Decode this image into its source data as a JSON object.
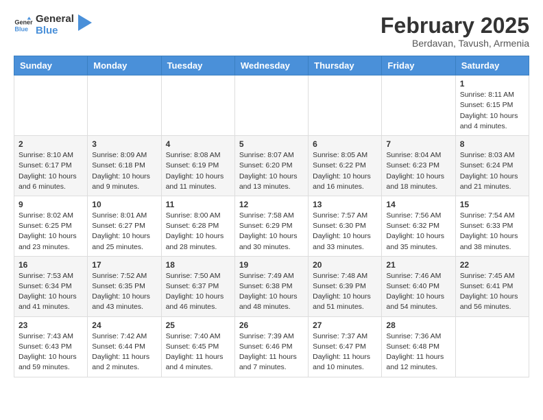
{
  "header": {
    "logo": {
      "general": "General",
      "blue": "Blue"
    },
    "title": "February 2025",
    "subtitle": "Berdavan, Tavush, Armenia"
  },
  "calendar": {
    "weekdays": [
      "Sunday",
      "Monday",
      "Tuesday",
      "Wednesday",
      "Thursday",
      "Friday",
      "Saturday"
    ],
    "weeks": [
      [
        {
          "day": "",
          "info": ""
        },
        {
          "day": "",
          "info": ""
        },
        {
          "day": "",
          "info": ""
        },
        {
          "day": "",
          "info": ""
        },
        {
          "day": "",
          "info": ""
        },
        {
          "day": "",
          "info": ""
        },
        {
          "day": "1",
          "info": "Sunrise: 8:11 AM\nSunset: 6:15 PM\nDaylight: 10 hours and 4 minutes."
        }
      ],
      [
        {
          "day": "2",
          "info": "Sunrise: 8:10 AM\nSunset: 6:17 PM\nDaylight: 10 hours and 6 minutes."
        },
        {
          "day": "3",
          "info": "Sunrise: 8:09 AM\nSunset: 6:18 PM\nDaylight: 10 hours and 9 minutes."
        },
        {
          "day": "4",
          "info": "Sunrise: 8:08 AM\nSunset: 6:19 PM\nDaylight: 10 hours and 11 minutes."
        },
        {
          "day": "5",
          "info": "Sunrise: 8:07 AM\nSunset: 6:20 PM\nDaylight: 10 hours and 13 minutes."
        },
        {
          "day": "6",
          "info": "Sunrise: 8:05 AM\nSunset: 6:22 PM\nDaylight: 10 hours and 16 minutes."
        },
        {
          "day": "7",
          "info": "Sunrise: 8:04 AM\nSunset: 6:23 PM\nDaylight: 10 hours and 18 minutes."
        },
        {
          "day": "8",
          "info": "Sunrise: 8:03 AM\nSunset: 6:24 PM\nDaylight: 10 hours and 21 minutes."
        }
      ],
      [
        {
          "day": "9",
          "info": "Sunrise: 8:02 AM\nSunset: 6:25 PM\nDaylight: 10 hours and 23 minutes."
        },
        {
          "day": "10",
          "info": "Sunrise: 8:01 AM\nSunset: 6:27 PM\nDaylight: 10 hours and 25 minutes."
        },
        {
          "day": "11",
          "info": "Sunrise: 8:00 AM\nSunset: 6:28 PM\nDaylight: 10 hours and 28 minutes."
        },
        {
          "day": "12",
          "info": "Sunrise: 7:58 AM\nSunset: 6:29 PM\nDaylight: 10 hours and 30 minutes."
        },
        {
          "day": "13",
          "info": "Sunrise: 7:57 AM\nSunset: 6:30 PM\nDaylight: 10 hours and 33 minutes."
        },
        {
          "day": "14",
          "info": "Sunrise: 7:56 AM\nSunset: 6:32 PM\nDaylight: 10 hours and 35 minutes."
        },
        {
          "day": "15",
          "info": "Sunrise: 7:54 AM\nSunset: 6:33 PM\nDaylight: 10 hours and 38 minutes."
        }
      ],
      [
        {
          "day": "16",
          "info": "Sunrise: 7:53 AM\nSunset: 6:34 PM\nDaylight: 10 hours and 41 minutes."
        },
        {
          "day": "17",
          "info": "Sunrise: 7:52 AM\nSunset: 6:35 PM\nDaylight: 10 hours and 43 minutes."
        },
        {
          "day": "18",
          "info": "Sunrise: 7:50 AM\nSunset: 6:37 PM\nDaylight: 10 hours and 46 minutes."
        },
        {
          "day": "19",
          "info": "Sunrise: 7:49 AM\nSunset: 6:38 PM\nDaylight: 10 hours and 48 minutes."
        },
        {
          "day": "20",
          "info": "Sunrise: 7:48 AM\nSunset: 6:39 PM\nDaylight: 10 hours and 51 minutes."
        },
        {
          "day": "21",
          "info": "Sunrise: 7:46 AM\nSunset: 6:40 PM\nDaylight: 10 hours and 54 minutes."
        },
        {
          "day": "22",
          "info": "Sunrise: 7:45 AM\nSunset: 6:41 PM\nDaylight: 10 hours and 56 minutes."
        }
      ],
      [
        {
          "day": "23",
          "info": "Sunrise: 7:43 AM\nSunset: 6:43 PM\nDaylight: 10 hours and 59 minutes."
        },
        {
          "day": "24",
          "info": "Sunrise: 7:42 AM\nSunset: 6:44 PM\nDaylight: 11 hours and 2 minutes."
        },
        {
          "day": "25",
          "info": "Sunrise: 7:40 AM\nSunset: 6:45 PM\nDaylight: 11 hours and 4 minutes."
        },
        {
          "day": "26",
          "info": "Sunrise: 7:39 AM\nSunset: 6:46 PM\nDaylight: 11 hours and 7 minutes."
        },
        {
          "day": "27",
          "info": "Sunrise: 7:37 AM\nSunset: 6:47 PM\nDaylight: 11 hours and 10 minutes."
        },
        {
          "day": "28",
          "info": "Sunrise: 7:36 AM\nSunset: 6:48 PM\nDaylight: 11 hours and 12 minutes."
        },
        {
          "day": "",
          "info": ""
        }
      ]
    ]
  }
}
